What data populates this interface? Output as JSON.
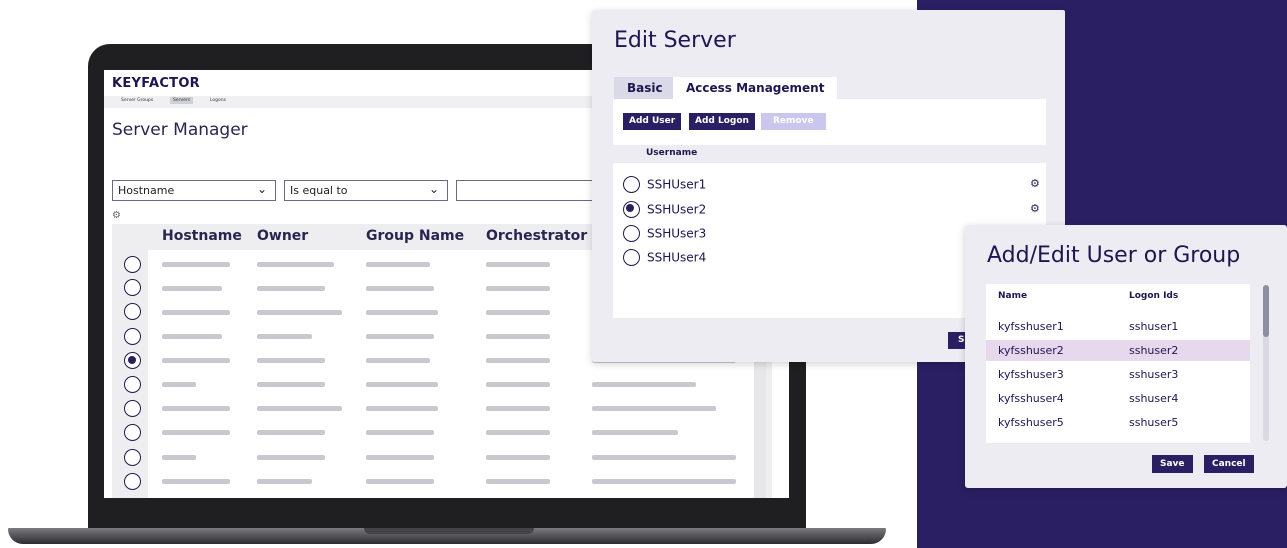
{
  "laptop_app": {
    "logo": "KEYFACTOR",
    "nav": [
      "Server Groups",
      "Servers",
      "Logons"
    ],
    "title": "Server Manager",
    "filter_field": "Hostname",
    "filter_operator": "Is equal to",
    "columns": [
      "Hostname",
      "Owner",
      "Group Name",
      "Orchestrator"
    ],
    "selected_row_index": 4
  },
  "edit_server": {
    "title": "Edit Server",
    "tabs": [
      "Basic",
      "Access Management"
    ],
    "buttons": {
      "add_user": "Add User",
      "add_logon": "Add Logon",
      "remove": "Remove"
    },
    "column_username": "Username",
    "users": [
      "SSHUser1",
      "SSHUser2",
      "SSHUser3",
      "SSHUser4"
    ],
    "selected_user": "SSHUser2",
    "save_label": "S"
  },
  "add_edit_user": {
    "title": "Add/Edit User or Group",
    "columns": {
      "name": "Name",
      "logon_ids": "Logon Ids"
    },
    "rows": [
      {
        "name": "kyfsshuser1",
        "logon": "sshuser1"
      },
      {
        "name": "kyfsshuser2",
        "logon": "sshuser2"
      },
      {
        "name": "kyfsshuser3",
        "logon": "sshuser3"
      },
      {
        "name": "kyfsshuser4",
        "logon": "sshuser4"
      },
      {
        "name": "kyfsshuser5",
        "logon": "sshuser5"
      }
    ],
    "selected_row": "kyfsshuser2",
    "buttons": {
      "save": "Save",
      "cancel": "Cancel"
    }
  },
  "colors": {
    "brand_purple": "#2b1f63",
    "selected_row": "#e8d8ee",
    "disabled_button": "#cac7ef"
  }
}
